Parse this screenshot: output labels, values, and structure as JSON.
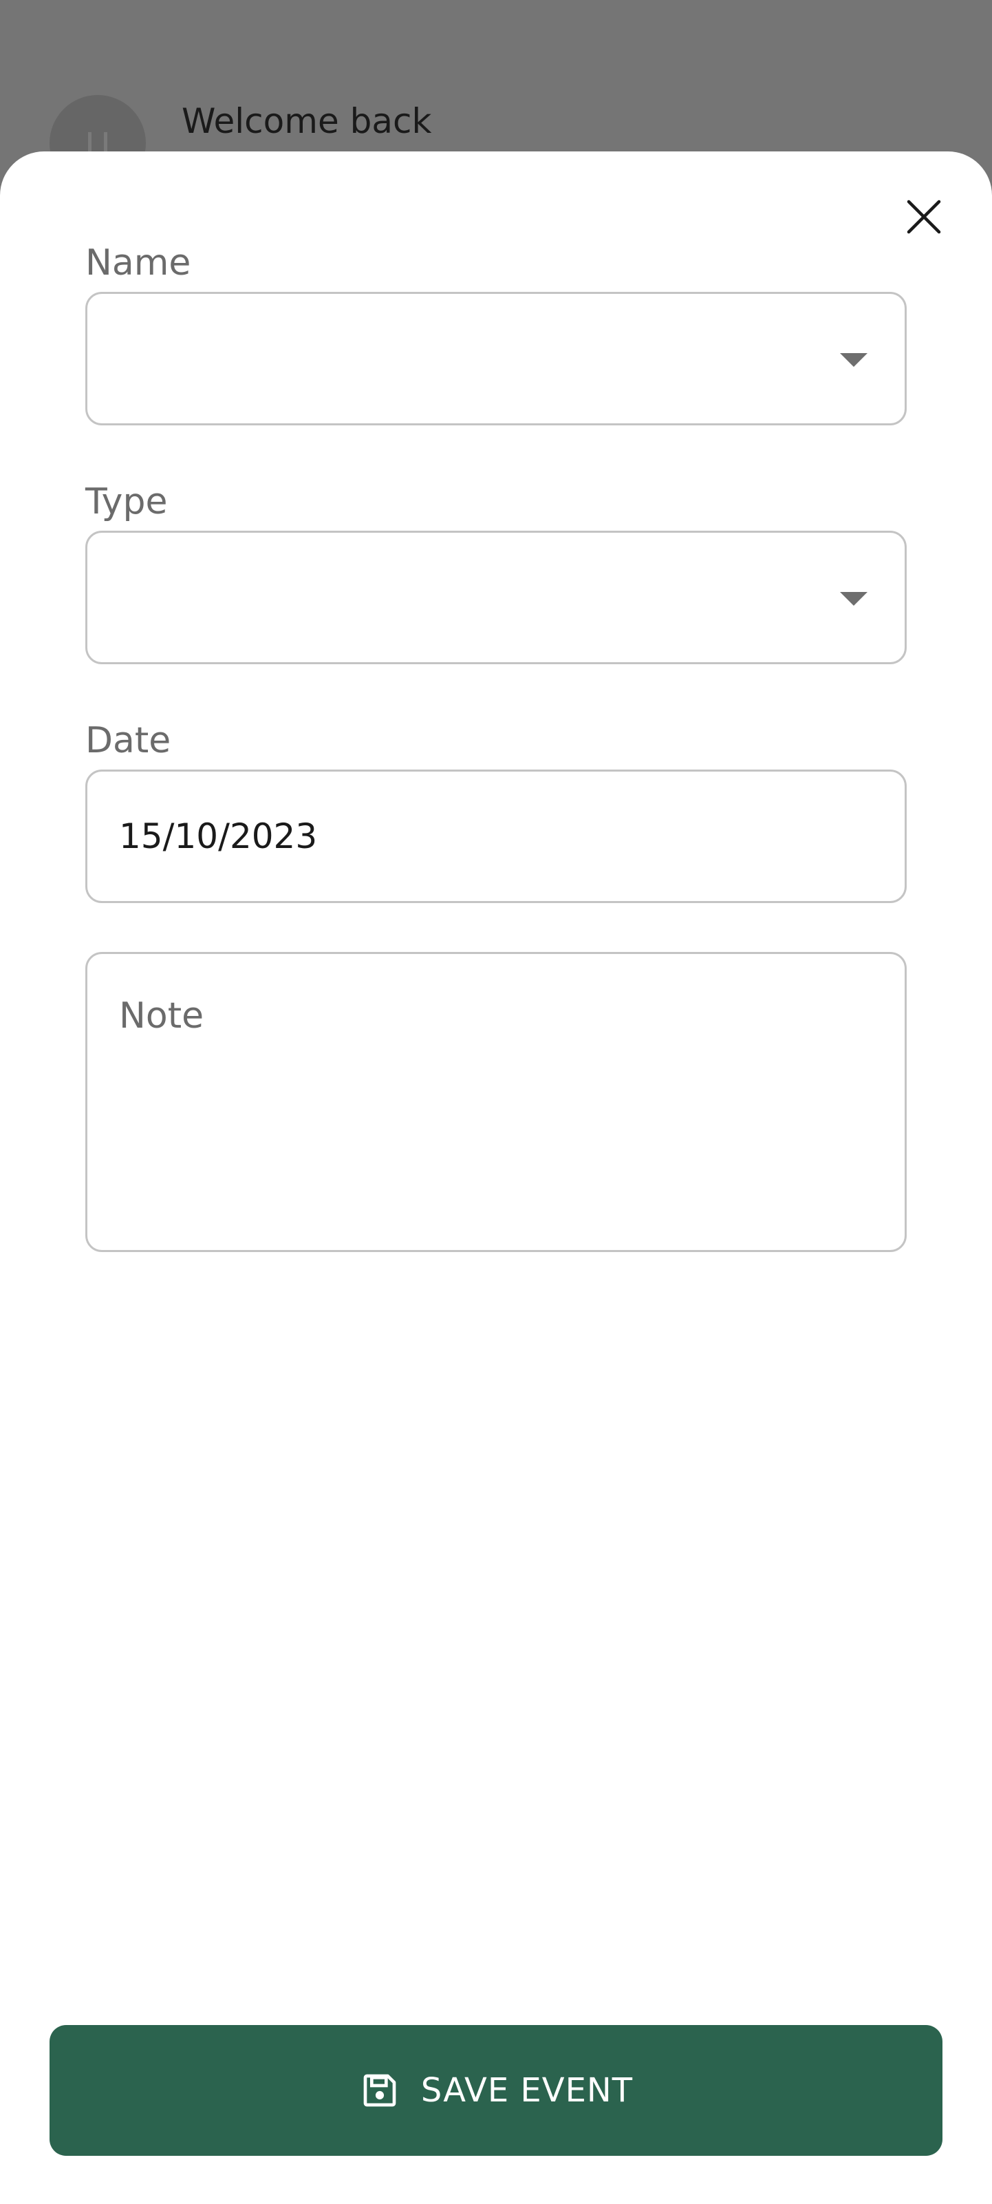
{
  "header": {
    "welcome_text": "Welcome back"
  },
  "form": {
    "name": {
      "label": "Name",
      "value": ""
    },
    "type": {
      "label": "Type",
      "value": ""
    },
    "date": {
      "label": "Date",
      "value": "15/10/2023"
    },
    "note": {
      "placeholder": "Note",
      "value": ""
    }
  },
  "actions": {
    "save_label": "SAVE EVENT"
  },
  "colors": {
    "primary": "#2b634e",
    "scrim": "#757575",
    "border": "#c4c4c4",
    "label": "#6b6b6b"
  },
  "icons": {
    "close": "close-icon",
    "dropdown": "caret-down-icon",
    "save": "floppy-disk-icon",
    "avatar": "avatar"
  }
}
